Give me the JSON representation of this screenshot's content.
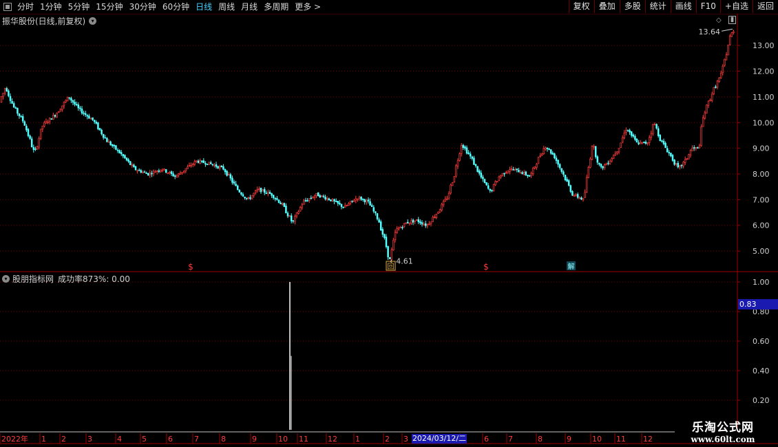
{
  "toolbar": {
    "periods": [
      "分时",
      "1分钟",
      "5分钟",
      "15分钟",
      "30分钟",
      "60分钟",
      "日线",
      "周线",
      "月线",
      "多周期",
      "更多 >"
    ],
    "active_period": "日线",
    "buttons": [
      "复权",
      "叠加",
      "多股",
      "统计",
      "画线",
      "F10",
      "+自选",
      "返回"
    ]
  },
  "main_chart": {
    "title": "振华股份(日线,前复权)",
    "y_ticks": [
      "13.00",
      "12.00",
      "11.00",
      "10.00",
      "9.00",
      "8.00",
      "7.00",
      "6.00",
      "5.00"
    ],
    "high_label": "13.64",
    "low_label": "4.61",
    "markers": [
      "$",
      "回",
      "$",
      "解"
    ],
    "ylim": [
      4.2,
      13.7
    ]
  },
  "indicator": {
    "name": "股朋指标网",
    "value_text": "成功率873%: 0.00",
    "y_ticks": [
      "1.00",
      "0.80",
      "0.60",
      "0.40",
      "0.20"
    ],
    "current_value": "0.83",
    "ylim": [
      0,
      1.0
    ]
  },
  "x_axis": {
    "labels": [
      "2022年",
      "1",
      "2",
      "3",
      "4",
      "5",
      "6",
      "7",
      "8",
      "9",
      "10",
      "11",
      "12",
      "1",
      "2",
      "3",
      "4",
      "5",
      "6",
      "7",
      "8",
      "9",
      "10",
      "11",
      "12"
    ],
    "highlight_date": "2024/03/12/二"
  },
  "watermark": {
    "line1": "乐淘公式网",
    "line2": "www.60lt.com"
  },
  "colors": {
    "up": "#ff3c3c",
    "down": "#54ffff",
    "grid": "#7a0000",
    "axis": "#a00000",
    "active": "#3fd0ff"
  },
  "chart_data": {
    "type": "candlestick",
    "price_path": [
      [
        0,
        10.8
      ],
      [
        8,
        11.4
      ],
      [
        20,
        10.6
      ],
      [
        35,
        10.0
      ],
      [
        50,
        8.8
      ],
      [
        62,
        9.9
      ],
      [
        80,
        10.3
      ],
      [
        100,
        11.0
      ],
      [
        115,
        10.5
      ],
      [
        135,
        10.1
      ],
      [
        155,
        9.3
      ],
      [
        175,
        8.8
      ],
      [
        195,
        8.2
      ],
      [
        215,
        8.0
      ],
      [
        235,
        8.2
      ],
      [
        255,
        7.9
      ],
      [
        270,
        8.2
      ],
      [
        285,
        8.5
      ],
      [
        305,
        8.4
      ],
      [
        325,
        8.2
      ],
      [
        345,
        7.4
      ],
      [
        360,
        7.0
      ],
      [
        375,
        7.4
      ],
      [
        395,
        7.2
      ],
      [
        410,
        6.8
      ],
      [
        425,
        6.1
      ],
      [
        440,
        6.9
      ],
      [
        460,
        7.2
      ],
      [
        480,
        7.0
      ],
      [
        500,
        6.7
      ],
      [
        520,
        7.1
      ],
      [
        535,
        6.9
      ],
      [
        550,
        6.2
      ],
      [
        560,
        5.3
      ],
      [
        566,
        4.61
      ],
      [
        575,
        5.8
      ],
      [
        590,
        6.1
      ],
      [
        605,
        6.2
      ],
      [
        620,
        6.0
      ],
      [
        635,
        6.5
      ],
      [
        650,
        7.1
      ],
      [
        660,
        8.0
      ],
      [
        670,
        9.2
      ],
      [
        685,
        8.6
      ],
      [
        700,
        7.8
      ],
      [
        712,
        7.3
      ],
      [
        725,
        7.9
      ],
      [
        740,
        8.2
      ],
      [
        755,
        8.1
      ],
      [
        770,
        7.9
      ],
      [
        780,
        8.5
      ],
      [
        792,
        9.1
      ],
      [
        805,
        8.7
      ],
      [
        818,
        8.0
      ],
      [
        832,
        7.2
      ],
      [
        848,
        7.0
      ],
      [
        860,
        9.2
      ],
      [
        872,
        8.2
      ],
      [
        885,
        8.5
      ],
      [
        898,
        9.0
      ],
      [
        910,
        9.8
      ],
      [
        925,
        9.2
      ],
      [
        940,
        9.2
      ],
      [
        950,
        10.0
      ],
      [
        960,
        9.3
      ],
      [
        972,
        8.8
      ],
      [
        985,
        8.2
      ],
      [
        995,
        8.5
      ],
      [
        1005,
        9.0
      ],
      [
        1015,
        9.0
      ],
      [
        1022,
        10.3
      ],
      [
        1035,
        11.2
      ],
      [
        1048,
        11.9
      ],
      [
        1060,
        13.3
      ],
      [
        1066,
        13.64
      ],
      [
        1072,
        12.6
      ]
    ],
    "indicator_spike_x_label": "2023-10",
    "indicator_spike_value": 1.0
  }
}
